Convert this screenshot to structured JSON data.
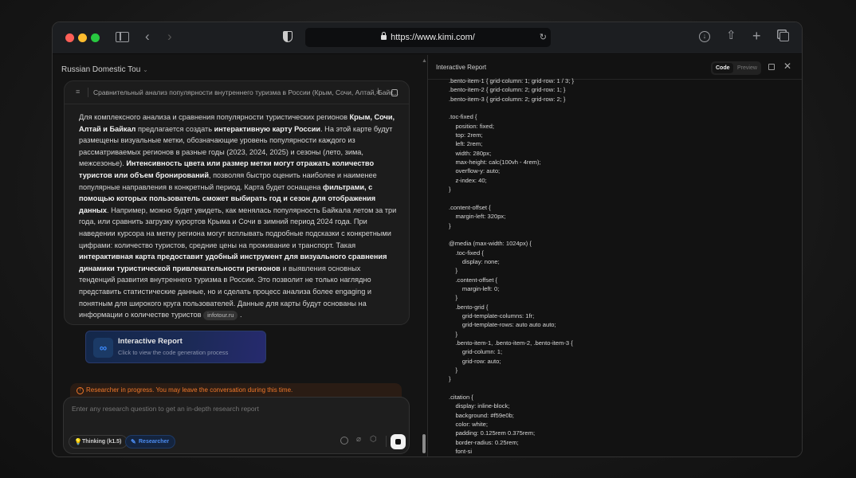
{
  "browser": {
    "url": "https://www.kimi.com/",
    "traffic_lights": {
      "close": "#fe5f57",
      "minimize": "#febc2e",
      "maximize": "#28c840"
    }
  },
  "chat": {
    "title": "Russian Domestic Tou",
    "message_header": "Сравнительный анализ популярности внутреннего туризма в России (Крым, Сочи, Алтай, Байк...",
    "paragraph": [
      {
        "t": "Для комплексного анализа и сравнения популярности туристических регионов ",
        "b": false
      },
      {
        "t": "Крым, Сочи, Алтай и Байкал",
        "b": true
      },
      {
        "t": " предлагается создать ",
        "b": false
      },
      {
        "t": "интерактивную карту России",
        "b": true
      },
      {
        "t": ". На этой карте будут размещены визуальные метки, обозначающие уровень популярности каждого из рассматриваемых регионов в разные годы (2023, 2024, 2025) и сезоны (лето, зима, межсезонье). ",
        "b": false
      },
      {
        "t": "Интенсивность цвета или размер метки могут отражать количество туристов или объем бронирований",
        "b": true
      },
      {
        "t": ", позволяя быстро оценить наиболее и наименее популярные направления в конкретный период. Карта будет оснащена ",
        "b": false
      },
      {
        "t": "фильтрами, с помощью которых пользователь сможет выбирать год и сезон для отображения данных",
        "b": true
      },
      {
        "t": ". Например, можно будет увидеть, как менялась популярность Байкала летом за три года, или сравнить загрузку курортов Крыма и Сочи в зимний период 2024 года. При наведении курсора на метку региона могут всплывать подробные подсказки с конкретными цифрами: количество туристов, средние цены на проживание и транспорт. Такая ",
        "b": false
      },
      {
        "t": "интерактивная карта предоставит удобный инструмент для визуального сравнения динамики туристической привлекательности регионов",
        "b": true
      },
      {
        "t": " и выявления основных тенденций развития внутреннего туризма в России. Это позволит не только наглядно представить статистические данные, но и сделать процесс анализа более engaging и понятным для широкого круга пользователей. Данные для карты будут основаны на информации о количестве туристов ",
        "b": false
      }
    ],
    "citation": "infotour.ru",
    "paragraph_end": " .",
    "report_card": {
      "title": "Interactive Report",
      "subtitle": "Click to view the code generation process"
    },
    "status_banner": "Researcher in progress. You may leave the conversation during this time.",
    "input_placeholder": "Enter any research question to get an in-depth research report",
    "chips": {
      "thinking": "Thinking (k1.5)",
      "researcher": "Researcher"
    }
  },
  "panel": {
    "title": "Interactive Report",
    "tabs": {
      "code": "Code",
      "preview": "Preview"
    },
    "active_tab": "Code",
    "code_lines": [
      ".bento-item-1 { grid-column: 1; grid-row: 1 / 3; }",
      ".bento-item-2 { grid-column: 2; grid-row: 1; }",
      ".bento-item-3 { grid-column: 2; grid-row: 2; }",
      "",
      ".toc-fixed {",
      "    position: fixed;",
      "    top: 2rem;",
      "    left: 2rem;",
      "    width: 280px;",
      "    max-height: calc(100vh - 4rem);",
      "    overflow-y: auto;",
      "    z-index: 40;",
      "}",
      "",
      ".content-offset {",
      "    margin-left: 320px;",
      "}",
      "",
      "@media (max-width: 1024px) {",
      "    .toc-fixed {",
      "        display: none;",
      "    }",
      "    .content-offset {",
      "        margin-left: 0;",
      "    }",
      "    .bento-grid {",
      "        grid-template-columns: 1fr;",
      "        grid-template-rows: auto auto auto;",
      "    }",
      "    .bento-item-1, .bento-item-2, .bento-item-3 {",
      "        grid-column: 1;",
      "        grid-row: auto;",
      "    }",
      "}",
      "",
      ".citation {",
      "    display: inline-block;",
      "    background: #f59e0b;",
      "    color: white;",
      "    padding: 0.125rem 0.375rem;",
      "    border-radius: 0.25rem;",
      "    font-si"
    ]
  }
}
